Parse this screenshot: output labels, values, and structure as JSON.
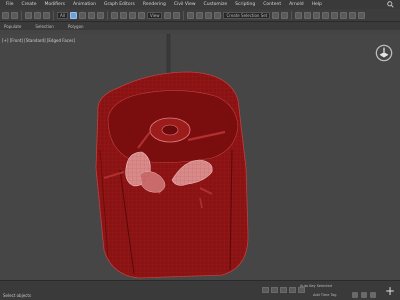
{
  "menu": {
    "items": [
      "File",
      "Create",
      "Modifiers",
      "Animation",
      "Graph Editors",
      "Rendering",
      "Civil View",
      "Customize",
      "Scripting",
      "Content",
      "Arnold",
      "Help"
    ]
  },
  "toolbar": {
    "view_dropdown": "View",
    "selection_set": "Create Selection Set"
  },
  "ribbon": {
    "tabs": [
      "Populate",
      "Selection",
      "Polygon"
    ]
  },
  "viewport": {
    "label": "[+] [Front] [Standard] [Edged Faces]"
  },
  "status": {
    "text": "Select objects",
    "anim_label": "Auto Key  Selected",
    "keys_label": "Add Time Tag"
  },
  "colors": {
    "model_red": "#8a1212",
    "model_edge": "#c04040",
    "background": "#464646"
  },
  "icons": [
    "search-icon",
    "viewcube-icon",
    "add-icon"
  ]
}
